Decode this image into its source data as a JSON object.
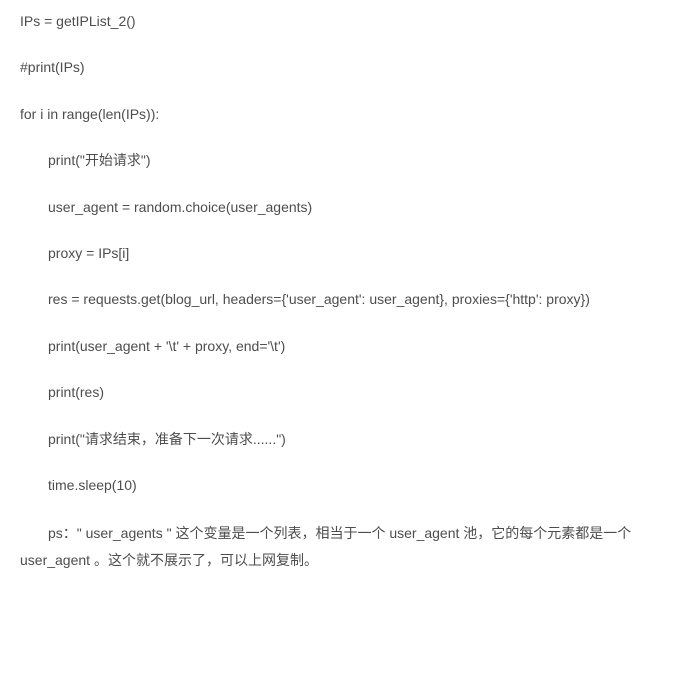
{
  "code": {
    "line1": "IPs = getIPList_2()",
    "line2": "#print(IPs)",
    "line3": "for i in range(len(IPs)):",
    "line4": "print(\"开始请求\")",
    "line5": "user_agent = random.choice(user_agents)",
    "line6": "proxy = IPs[i]",
    "line7": "res = requests.get(blog_url, headers={'user_agent': user_agent}, proxies={'http': proxy})",
    "line8": "print(user_agent + '\\t' + proxy, end='\\t')",
    "line9": "print(res)",
    "line10": "print(\"请求结束，准备下一次请求......\")",
    "line11": "time.sleep(10)"
  },
  "paragraph": {
    "text": "ps：\" user_agents \" 这个变量是一个列表，相当于一个 user_agent 池，它的每个元素都是一个 user_agent 。这个就不展示了，可以上网复制。"
  }
}
